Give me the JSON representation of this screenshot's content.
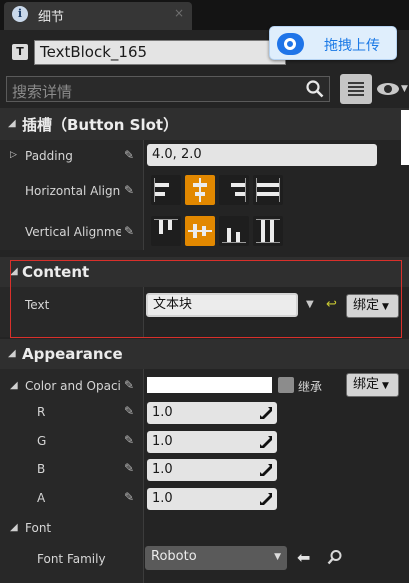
{
  "tab": {
    "icon": "info-icon",
    "title": "细节",
    "close": "×"
  },
  "header": {
    "type_icon": "T",
    "widget_name": "TextBlock_165",
    "upload_button": "拖拽上传"
  },
  "search": {
    "placeholder": "搜索详情"
  },
  "slot_section": {
    "title": "插槽（Button Slot）",
    "padding": {
      "label": "Padding",
      "value": "4.0, 2.0"
    },
    "horizontal_alignment": {
      "label": "Horizontal Alignm",
      "selected_index": 1
    },
    "vertical_alignment": {
      "label": "Vertical Alignme",
      "selected_index": 1
    }
  },
  "content_section": {
    "title": "Content",
    "text": {
      "label": "Text",
      "value": "文本块",
      "bind_label": "绑定"
    }
  },
  "appearance_section": {
    "title": "Appearance",
    "color_opacity": {
      "label": "Color and Opacit",
      "inherit_label": "继承",
      "bind_label": "绑定",
      "swatch_color": "#ffffff"
    },
    "channels": [
      {
        "label": "R",
        "value": "1.0"
      },
      {
        "label": "G",
        "value": "1.0"
      },
      {
        "label": "B",
        "value": "1.0"
      },
      {
        "label": "A",
        "value": "1.0"
      }
    ]
  },
  "font_section": {
    "title": "Font",
    "font_family": {
      "label": "Font Family",
      "value": "Roboto"
    }
  },
  "colors": {
    "accent": "#e28800",
    "highlight_box": "#d9302b",
    "upload_blue": "#1c7ae6"
  }
}
